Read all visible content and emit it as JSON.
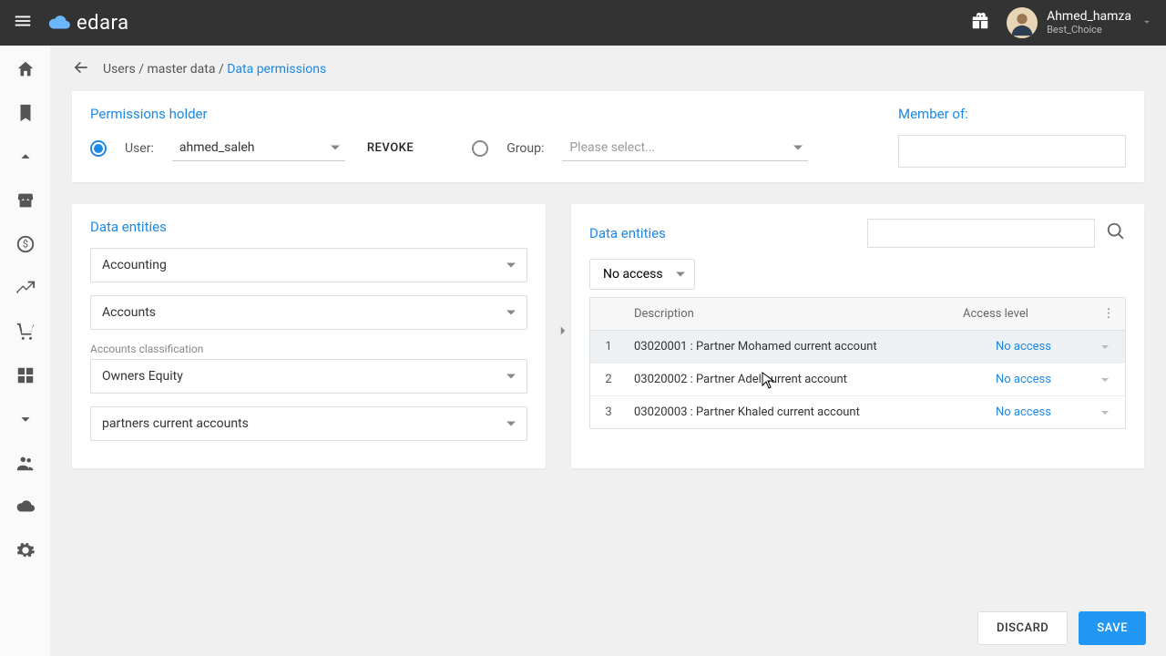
{
  "header": {
    "brand": "edara",
    "user_name": "Ahmed_hamza",
    "user_sub": "Best_Choice"
  },
  "breadcrumb": {
    "p1": "Users",
    "p2": "master data",
    "current": "Data permissions"
  },
  "perm": {
    "title": "Permissions holder",
    "user_label": "User:",
    "user_value": "ahmed_saleh",
    "revoke": "REVOKE",
    "group_label": "Group:",
    "group_placeholder": "Please select...",
    "member_title": "Member of:"
  },
  "left": {
    "title": "Data entities",
    "cat": "Accounting",
    "sub": "Accounts",
    "class_label": "Accounts classification",
    "class_val": "Owners Equity",
    "leaf": "partners current accounts"
  },
  "right": {
    "title": "Data entities",
    "access_sel": "No access",
    "col_desc": "Description",
    "col_acc": "Access level",
    "rows": [
      {
        "n": "1",
        "d": "03020001 : Partner Mohamed current account",
        "a": "No access"
      },
      {
        "n": "2",
        "d": "03020002 : Partner Adel current account",
        "a": "No access"
      },
      {
        "n": "3",
        "d": "03020003 : Partner Khaled current account",
        "a": "No access"
      }
    ]
  },
  "footer": {
    "discard": "DISCARD",
    "save": "SAVE"
  }
}
